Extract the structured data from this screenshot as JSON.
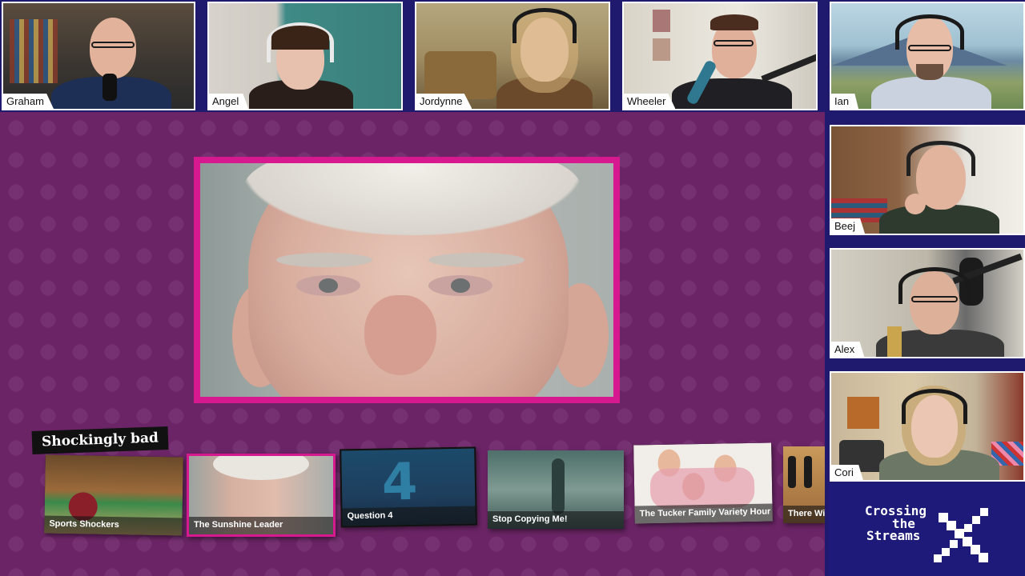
{
  "participants": [
    {
      "name": "Graham"
    },
    {
      "name": "Angel"
    },
    {
      "name": "Jordynne"
    },
    {
      "name": "Wheeler"
    },
    {
      "name": "Ian"
    },
    {
      "name": "Beej"
    },
    {
      "name": "Alex"
    },
    {
      "name": "Cori"
    }
  ],
  "carousel": {
    "category": "Shockingly bad",
    "items": [
      {
        "title": "Sports Shockers"
      },
      {
        "title": "The Sunshine Leader",
        "selected": true
      },
      {
        "title": "Question 4",
        "numeral": "4"
      },
      {
        "title": "Stop Copying Me!"
      },
      {
        "title": "The Tucker Family Variety Hour"
      },
      {
        "title": "There Will"
      }
    ]
  },
  "brand": {
    "line1": "Crossing",
    "line2": "the",
    "line3": "Streams"
  },
  "colors": {
    "highlight": "#d6198f",
    "stage_bg": "#6b2566",
    "frame_bg": "#201a6e"
  }
}
